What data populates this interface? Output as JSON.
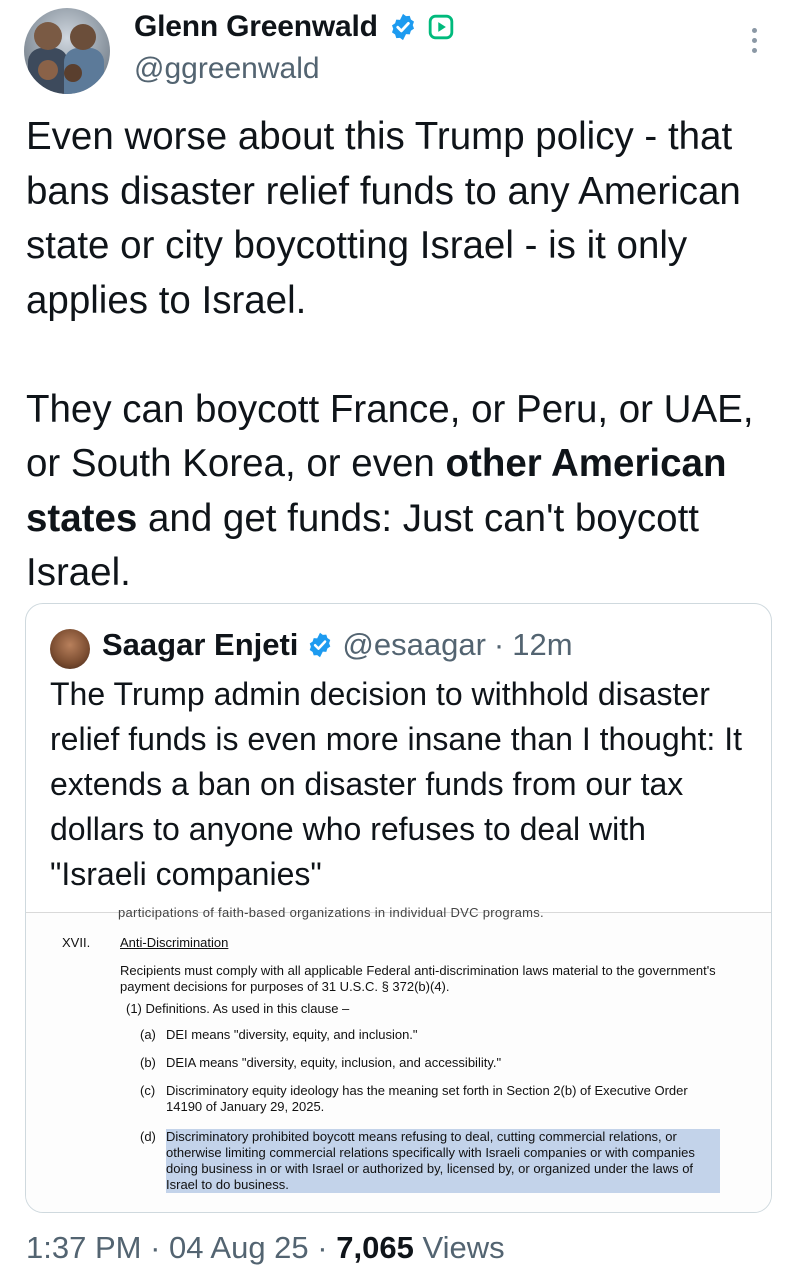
{
  "author": {
    "name": "Glenn Greenwald",
    "handle": "@ggreenwald"
  },
  "tweet": {
    "text_before_bold": "Even worse about this Trump policy - that bans disaster relief funds to any American state or city boycotting Israel - is it only applies to Israel.\n\nThey can boycott France, or Peru, or UAE, or South Korea, or even ",
    "bold": "other American states",
    "text_after_bold": " and get funds: Just can't boycott Israel."
  },
  "quote": {
    "name": "Saagar Enjeti",
    "handle": "@esaagar",
    "separator": "·",
    "age": "12m",
    "text": "The Trump admin decision to withhold disaster relief funds is even more insane than I thought: It extends a ban on disaster funds from our tax dollars to anyone who refuses to deal with \"Israeli companies\"",
    "document": {
      "cut_line": "participations of faith-based organizations in individual DVC programs.",
      "section_number": "XVII.",
      "section_title": "Anti-Discrimination",
      "paragraph": "Recipients must comply with all applicable Federal anti-discrimination laws material to the government's payment decisions for purposes of 31 U.S.C. § 372(b)(4).",
      "definitions_intro": "(1) Definitions. As used in this clause –",
      "items": [
        {
          "label": "(a)",
          "text": "DEI means \"diversity, equity, and inclusion.\""
        },
        {
          "label": "(b)",
          "text": "DEIA means \"diversity, equity, inclusion, and accessibility.\""
        },
        {
          "label": "(c)",
          "text": "Discriminatory equity ideology has the meaning set forth in Section 2(b) of Executive Order 14190 of January 29, 2025."
        },
        {
          "label": "(d)",
          "text": "Discriminatory prohibited boycott means refusing to deal, cutting commercial relations, or otherwise limiting commercial relations specifically with Israeli companies or with companies doing business in or with Israel or authorized by, licensed by, or organized under the laws of Israel to do business."
        }
      ]
    }
  },
  "footer": {
    "time": "1:37 PM",
    "dot1": "·",
    "date": "04 Aug 25",
    "dot2": "·",
    "views_count": "7,065",
    "views_label": "Views"
  },
  "colors": {
    "verified_blue": "#1d9bf0",
    "subscription_green": "#00ba7c",
    "secondary_text": "#536471",
    "highlight": "#c3d3ea"
  }
}
